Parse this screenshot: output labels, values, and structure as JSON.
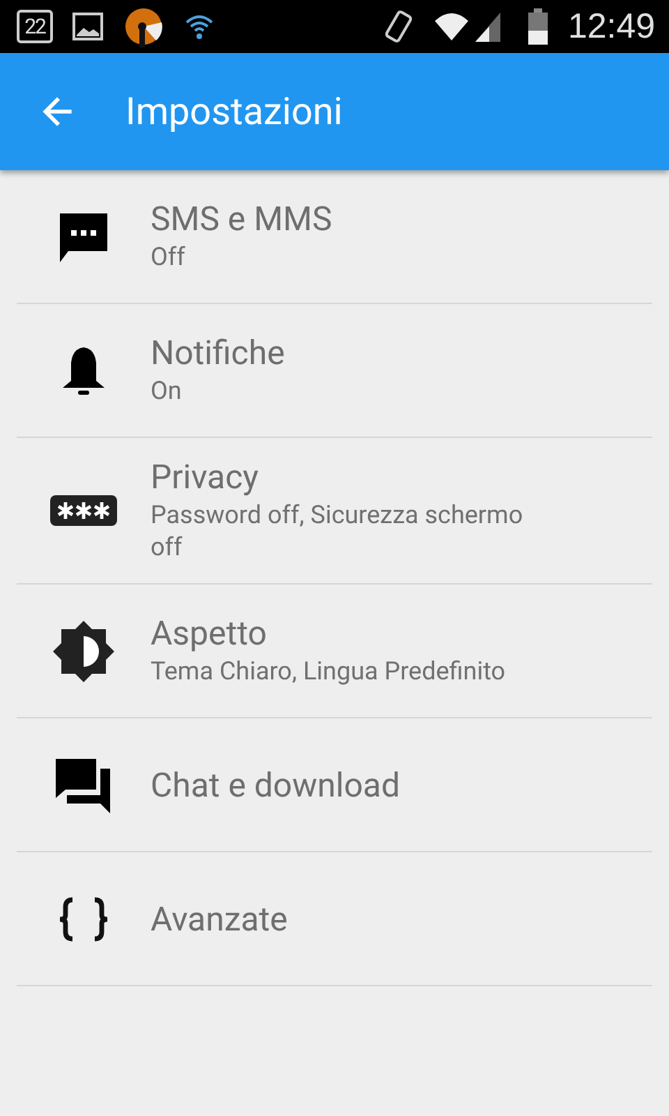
{
  "status_bar": {
    "date_badge": "22",
    "time": "12:49"
  },
  "toolbar": {
    "title": "Impostazioni"
  },
  "settings": [
    {
      "title": "SMS e MMS",
      "summary": "Off"
    },
    {
      "title": "Notifiche",
      "summary": "On"
    },
    {
      "title": "Privacy",
      "summary": "Password off, Sicurezza schermo off"
    },
    {
      "title": "Aspetto",
      "summary": "Tema Chiaro, Lingua Predefinito"
    },
    {
      "title": "Chat e download"
    },
    {
      "title": "Avanzate"
    }
  ]
}
